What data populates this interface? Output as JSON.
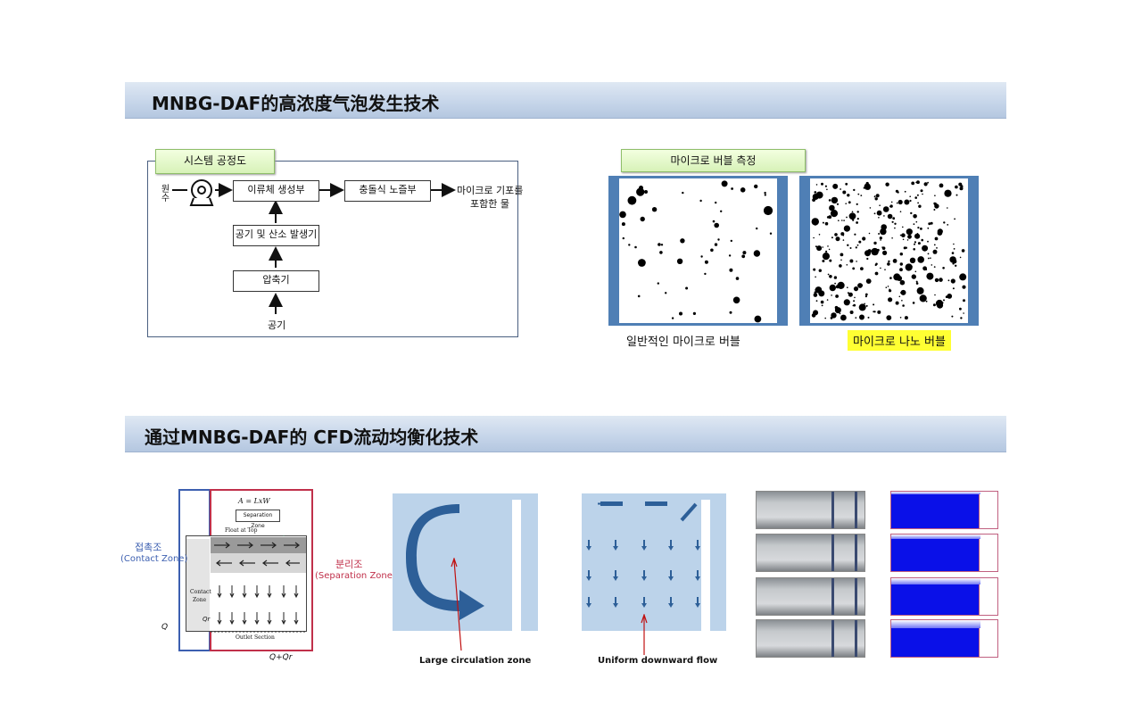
{
  "section1": {
    "title": "MNBG-DAF的高浓度气泡发生技术",
    "process_tag": "시스템 공정도",
    "inlet_label": "원수",
    "boxes": {
      "swirl": "이류체 생성부",
      "collision": "충돌식 노즐부",
      "gen": "공기 및 산소 발생기",
      "compressor": "압축기"
    },
    "air_label": "공기",
    "output_label_1": "마이크로 기포를",
    "output_label_2": "포함한 물",
    "measure_tag": "마이크로 버블 측정",
    "caption_micro": "일반적인 마이크로 버블",
    "caption_nano": "마이크로 나노 버블"
  },
  "section2": {
    "title": "通过MNBG-DAF的 CFD流动均衡化技术",
    "contact_ko": "접촉조",
    "contact_en": "(Contact Zone)",
    "separation_ko": "분리조",
    "separation_en": "(Separation Zone)",
    "formula": "A = LxW",
    "separation_small": "Separation Zone",
    "float_top": "Float at Top",
    "contact_small_1": "Contact",
    "contact_small_2": "Zone",
    "outlet": "Outlet Section",
    "q_in": "Q",
    "q_r": "Qr",
    "q_out": "Q+Qr",
    "large_circ": "Large circulation zone",
    "uniform": "Uniform downward flow"
  },
  "colors": {
    "banner": "#c7d6ea",
    "panel": "#bcd3ea",
    "arrow_blue": "#2d5f98",
    "cfd_blue": "#0a10e8",
    "highlight_yellow": "#ffff33",
    "contact_red": "#c0304a",
    "contact_blue": "#3c5fb0"
  }
}
